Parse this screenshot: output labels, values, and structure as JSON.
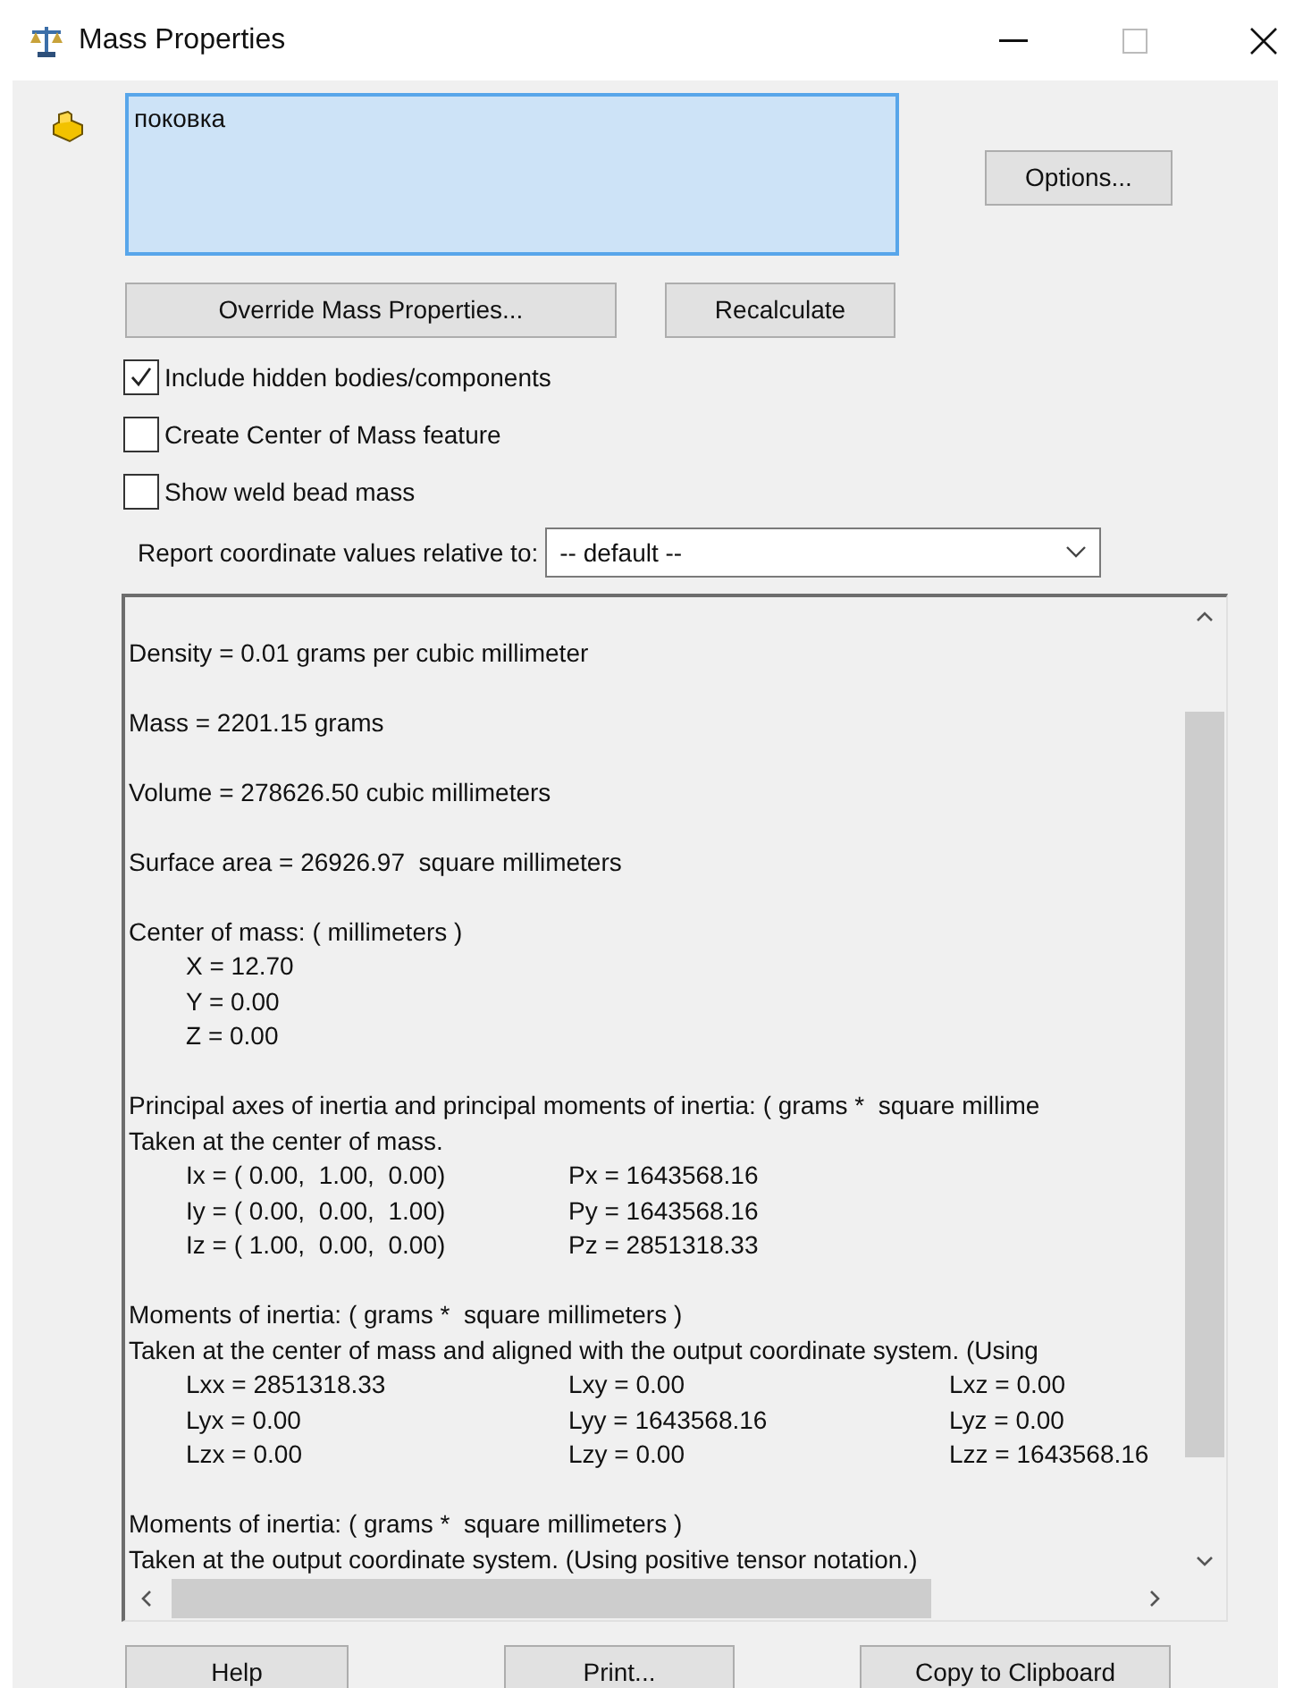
{
  "window": {
    "title": "Mass Properties"
  },
  "selection": {
    "value": "поковка"
  },
  "buttons": {
    "options": "Options...",
    "override": "Override Mass Properties...",
    "recalculate": "Recalculate"
  },
  "checkboxes": [
    {
      "label": "Include hidden bodies/components",
      "checked": true
    },
    {
      "label": "Create Center of Mass feature",
      "checked": false
    },
    {
      "label": "Show weld bead mass",
      "checked": false
    }
  ],
  "coordinate": {
    "label": "Report coordinate values relative to:",
    "value": "-- default --"
  },
  "report": [
    {
      "kind": "blank"
    },
    {
      "kind": "line",
      "text": "Density = 0.01 grams per cubic millimeter"
    },
    {
      "kind": "blank"
    },
    {
      "kind": "line",
      "text": "Mass = 2201.15 grams"
    },
    {
      "kind": "blank"
    },
    {
      "kind": "line",
      "text": "Volume = 278626.50 cubic millimeters"
    },
    {
      "kind": "blank"
    },
    {
      "kind": "line",
      "text": "Surface area = 26926.97  square millimeters"
    },
    {
      "kind": "blank"
    },
    {
      "kind": "line",
      "text": "Center of mass: ( millimeters )"
    },
    {
      "kind": "row",
      "cells": [
        "X = 12.70"
      ]
    },
    {
      "kind": "row",
      "cells": [
        "Y = 0.00"
      ]
    },
    {
      "kind": "row",
      "cells": [
        "Z = 0.00"
      ]
    },
    {
      "kind": "blank"
    },
    {
      "kind": "line",
      "text": "Principal axes of inertia and principal moments of inertia: ( grams *  square millime"
    },
    {
      "kind": "line",
      "text": "Taken at the center of mass."
    },
    {
      "kind": "row",
      "cells": [
        "Ix = ( 0.00,  1.00,  0.00)",
        "Px = 1643568.16"
      ]
    },
    {
      "kind": "row",
      "cells": [
        "Iy = ( 0.00,  0.00,  1.00)",
        "Py = 1643568.16"
      ]
    },
    {
      "kind": "row",
      "cells": [
        "Iz = ( 1.00,  0.00,  0.00)",
        "Pz = 2851318.33"
      ]
    },
    {
      "kind": "blank"
    },
    {
      "kind": "line",
      "text": "Moments of inertia: ( grams *  square millimeters )"
    },
    {
      "kind": "line",
      "text": "Taken at the center of mass and aligned with the output coordinate system. (Using"
    },
    {
      "kind": "row",
      "cells": [
        "Lxx = 2851318.33",
        "Lxy = 0.00",
        "Lxz = 0.00"
      ]
    },
    {
      "kind": "row",
      "cells": [
        "Lyx = 0.00",
        "Lyy = 1643568.16",
        "Lyz = 0.00"
      ]
    },
    {
      "kind": "row",
      "cells": [
        "Lzx = 0.00",
        "Lzy = 0.00",
        "Lzz = 1643568.16"
      ]
    },
    {
      "kind": "blank"
    },
    {
      "kind": "line",
      "text": "Moments of inertia: ( grams *  square millimeters )"
    },
    {
      "kind": "line",
      "text": "Taken at the output coordinate system. (Using positive tensor notation.)"
    }
  ],
  "footer": [
    "Help",
    "Print...",
    "Copy to Clipboard"
  ]
}
